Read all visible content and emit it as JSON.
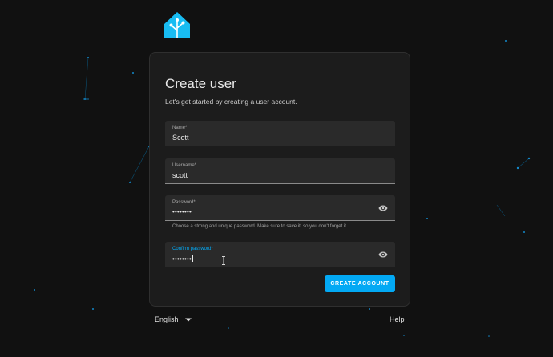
{
  "app": {
    "logo_icon": "home-assistant-logo-icon",
    "accent_color": "#03a9f4"
  },
  "card": {
    "title": "Create user",
    "subtitle": "Let's get started by creating a user account."
  },
  "form": {
    "name": {
      "label": "Name*",
      "value": "Scott"
    },
    "username": {
      "label": "Username*",
      "value": "scott"
    },
    "password": {
      "label": "Password*",
      "value": "••••••••",
      "helper": "Choose a strong and unique password. Make sure to save it, so you don't forget it."
    },
    "confirm_password": {
      "label": "Confirm password*",
      "value": "••••••••"
    },
    "submit_label": "CREATE ACCOUNT"
  },
  "footer": {
    "language": "English",
    "help": "Help"
  }
}
